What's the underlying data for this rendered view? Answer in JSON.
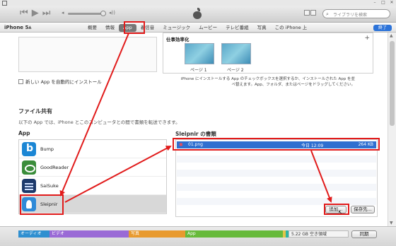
{
  "search": {
    "placeholder": "ライブラリを検索"
  },
  "device": {
    "name": "iPhone 5",
    "eject": "▲"
  },
  "nav": {
    "tabs": [
      {
        "label": "概要"
      },
      {
        "label": "情報"
      },
      {
        "label": "App"
      },
      {
        "label": "着信音"
      },
      {
        "label": "ミュージック"
      },
      {
        "label": "ムービー"
      },
      {
        "label": "テレビ番組"
      },
      {
        "label": "写真"
      },
      {
        "label": "この iPhone 上"
      }
    ],
    "done": "終了"
  },
  "homescreen": {
    "folder": "仕事効率化",
    "pages": [
      "ページ 1",
      "ページ 2"
    ],
    "note": "iPhone にインストールする App のチェックボックスを選択するか、インストールされた App を並べ替えます。App、フォルダ、またはページをドラッグしてください。"
  },
  "new_apps_checkbox": "新しい App を自動的にインストール",
  "file_sharing": {
    "title": "ファイル共有",
    "description": "以下の App では、iPhone とこのコンピュータとの間で書類を転送できます。",
    "apps_header": "App",
    "docs_header": "Sleipnir の書類",
    "apps": [
      {
        "name": "Bump",
        "icon": "bump-icon"
      },
      {
        "name": "GoodReader",
        "icon": "goodreader-icon"
      },
      {
        "name": "SaiSuke",
        "icon": "saisuke-icon"
      },
      {
        "name": "Sleipnir",
        "icon": "sleipnir-icon"
      }
    ],
    "documents": [
      {
        "name": "01.png",
        "date": "今日 12:09",
        "size": "264 KB"
      }
    ],
    "add_button": "追加...",
    "save_button": "保存先..."
  },
  "capacity": {
    "segments": [
      {
        "label": "オーディオ",
        "color": "#2f8fd0"
      },
      {
        "label": "ビデオ",
        "color": "#9a6ad6"
      },
      {
        "label": "写真",
        "color": "#e89a2f"
      },
      {
        "label": "App",
        "color": "#67ba3b"
      }
    ],
    "free": "5.22 GB 空き領域",
    "sync": "同期"
  },
  "annotation_color": "#e11b1b"
}
